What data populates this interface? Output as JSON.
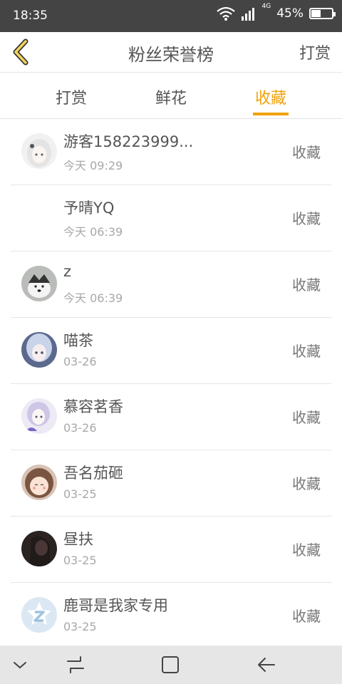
{
  "status": {
    "time": "18:35",
    "network": "4G",
    "battery": "45%",
    "battery_level": 0.45
  },
  "header": {
    "title": "粉丝荣誉榜",
    "action": "打赏"
  },
  "tabs": [
    {
      "label": "打赏",
      "active": false
    },
    {
      "label": "鲜花",
      "active": false
    },
    {
      "label": "收藏",
      "active": true
    }
  ],
  "colors": {
    "accent": "#f1a20a",
    "status_bar": "#444444"
  },
  "list": [
    {
      "name": "游客158223999...",
      "time": "今天 09:29",
      "action": "收藏",
      "avatar": "anime-girl-white-hair"
    },
    {
      "name": "予晴YQ",
      "time": "今天 06:39",
      "action": "收藏",
      "avatar": "none"
    },
    {
      "name": "z",
      "time": "今天 06:39",
      "action": "收藏",
      "avatar": "husky-dog"
    },
    {
      "name": "喵茶",
      "time": "03-26",
      "action": "收藏",
      "avatar": "anime-girl-blue"
    },
    {
      "name": "慕容茗香",
      "time": "03-26",
      "action": "收藏",
      "avatar": "anime-girl-purple"
    },
    {
      "name": "吾名茄砸",
      "time": "03-25",
      "action": "收藏",
      "avatar": "cartoon-girl-brown-hair"
    },
    {
      "name": "昼扶",
      "time": "03-25",
      "action": "收藏",
      "avatar": "dark-photo-girl"
    },
    {
      "name": "鹿哥是我家专用",
      "time": "03-25",
      "action": "收藏",
      "avatar": "qq-default-logo"
    }
  ],
  "navbar": {
    "icons": [
      "chevron-down-icon",
      "recent-apps-icon",
      "home-square-icon",
      "back-arrow-icon"
    ]
  }
}
